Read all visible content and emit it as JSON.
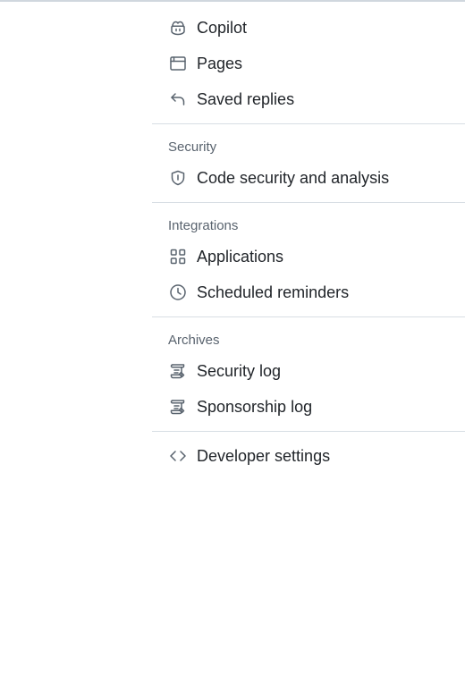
{
  "sidebar": {
    "top_items": [
      {
        "label": "Copilot",
        "icon": "copilot-icon"
      },
      {
        "label": "Pages",
        "icon": "browser-icon"
      },
      {
        "label": "Saved replies",
        "icon": "reply-icon"
      }
    ],
    "security": {
      "heading": "Security",
      "items": [
        {
          "label": "Code security and analysis",
          "icon": "shield-icon"
        }
      ]
    },
    "integrations": {
      "heading": "Integrations",
      "items": [
        {
          "label": "Applications",
          "icon": "apps-icon"
        },
        {
          "label": "Scheduled reminders",
          "icon": "clock-icon"
        }
      ]
    },
    "archives": {
      "heading": "Archives",
      "items": [
        {
          "label": "Security log",
          "icon": "log-icon"
        },
        {
          "label": "Sponsorship log",
          "icon": "log-icon"
        }
      ]
    },
    "developer": {
      "label": "Developer settings",
      "icon": "code-icon"
    }
  },
  "colors": {
    "text": "#1f2328",
    "muted": "#59636e",
    "divider": "#d8dee4"
  }
}
